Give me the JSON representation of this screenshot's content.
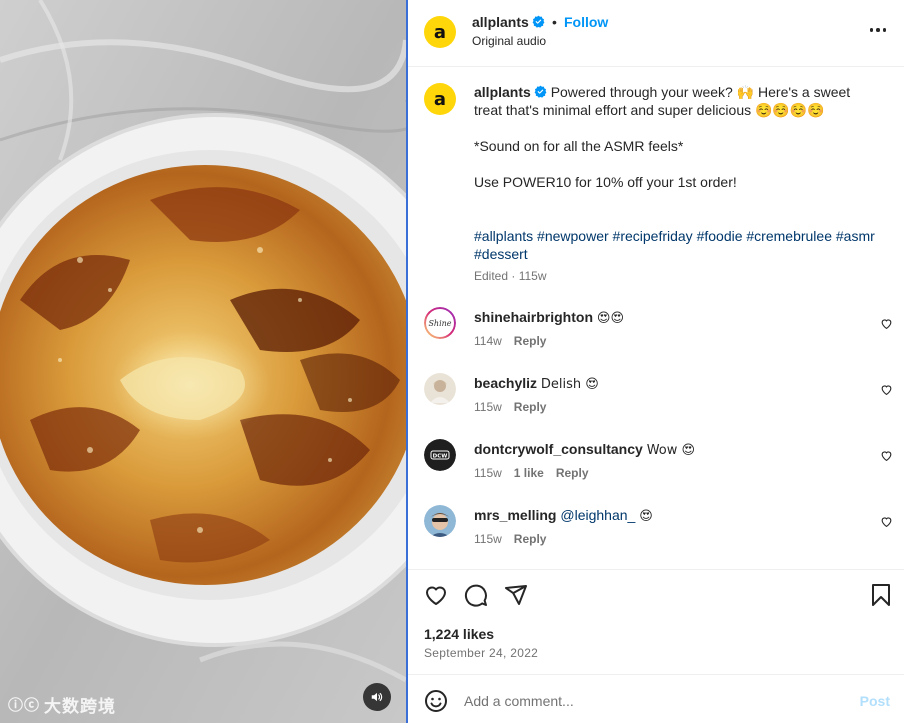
{
  "post": {
    "username": "allplants",
    "avatar_letter": "a",
    "follow_label": "Follow",
    "separator": "•",
    "audio": "Original audio",
    "caption": {
      "line1": "Powered through your week? 🙌 Here's a sweet treat that's minimal effort and super delicious ☺️☺️☺️☺️",
      "line2": "*Sound on for all the ASMR feels*",
      "line3": "Use POWER10 for 10% off your 1st order!",
      "hashtags": "#allplants #newpower #recipefriday #foodie #cremebrulee #asmr #dessert",
      "meta": "Edited · 115w"
    },
    "likes": "1,224 likes",
    "date": "September 24, 2022"
  },
  "comments": [
    {
      "user": "shinehairbrighton",
      "text": "😍😍",
      "age": "114w",
      "likes": "",
      "reply": "Reply",
      "avatar_text": "Shine"
    },
    {
      "user": "beachyliz",
      "text": "Delish 😍",
      "age": "115w",
      "likes": "",
      "reply": "Reply",
      "avatar_text": ""
    },
    {
      "user": "dontcrywolf_consultancy",
      "text": "Wow 😍",
      "age": "115w",
      "likes": "1 like",
      "reply": "Reply",
      "avatar_text": "DCW"
    },
    {
      "user": "mrs_melling",
      "mention": "@leighhan_",
      "text": "😍",
      "age": "115w",
      "likes": "",
      "reply": "Reply",
      "avatar_text": ""
    }
  ],
  "add_comment": {
    "placeholder": "Add a comment...",
    "post_label": "Post"
  },
  "watermark": {
    "text": "大数跨境",
    "mark": "ⓘⓒ"
  },
  "icons": {
    "verified": "verified-badge-icon",
    "more": "more-options-icon",
    "heart": "heart-icon",
    "comment": "comment-icon",
    "share": "share-icon",
    "save": "bookmark-icon",
    "emoji": "emoji-icon",
    "mute": "speaker-icon"
  },
  "colors": {
    "accent": "#0095f6",
    "link": "#00376b",
    "avatar_bg": "#ffd60a",
    "muted": "#737373",
    "post_disabled": "#b2dffc"
  }
}
